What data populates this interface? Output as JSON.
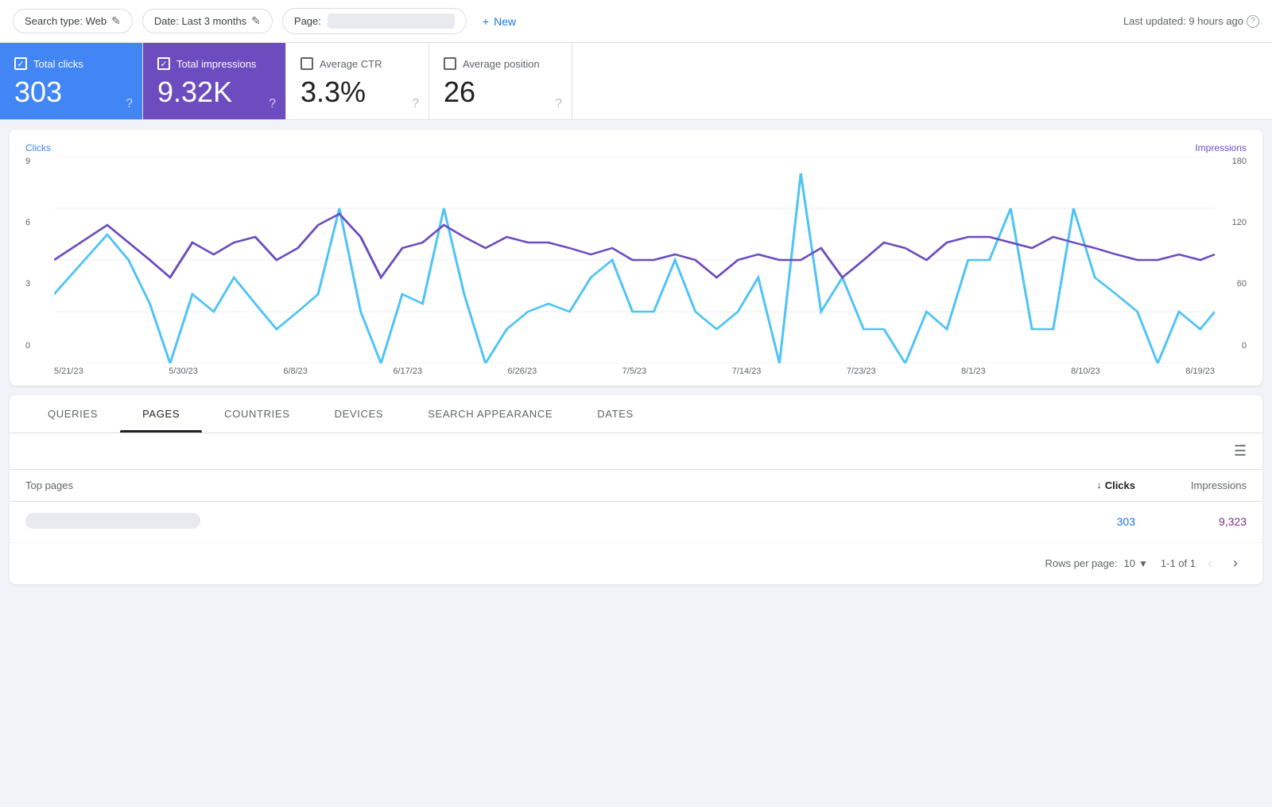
{
  "topbar": {
    "search_type_label": "Search type: Web",
    "edit_icon": "✎",
    "date_label": "Date: Last 3 months",
    "page_label": "Page:",
    "page_placeholder": "",
    "new_button_label": "New",
    "plus_icon": "+",
    "last_updated": "Last updated: 9 hours ago",
    "help_icon": "?"
  },
  "metrics": [
    {
      "id": "total-clicks",
      "label": "Total clicks",
      "value": "303",
      "state": "active-blue",
      "checked": true
    },
    {
      "id": "total-impressions",
      "label": "Total impressions",
      "value": "9.32K",
      "state": "active-purple",
      "checked": true
    },
    {
      "id": "average-ctr",
      "label": "Average CTR",
      "value": "3.3%",
      "state": "inactive",
      "checked": false
    },
    {
      "id": "average-position",
      "label": "Average position",
      "value": "26",
      "state": "inactive",
      "checked": false
    }
  ],
  "chart": {
    "left_axis_label": "Clicks",
    "right_axis_label": "Impressions",
    "left_axis_values": [
      "9",
      "6",
      "3",
      "0"
    ],
    "right_axis_values": [
      "180",
      "120",
      "60",
      "0"
    ],
    "x_axis_dates": [
      "5/21/23",
      "5/30/23",
      "6/8/23",
      "6/17/23",
      "6/26/23",
      "7/5/23",
      "7/14/23",
      "7/23/23",
      "8/1/23",
      "8/10/23",
      "8/19/23"
    ],
    "clicks_color": "#4fc3f7",
    "impressions_color": "#6c4cbf"
  },
  "tabs": [
    {
      "id": "queries",
      "label": "QUERIES",
      "active": false
    },
    {
      "id": "pages",
      "label": "PAGES",
      "active": true
    },
    {
      "id": "countries",
      "label": "COUNTRIES",
      "active": false
    },
    {
      "id": "devices",
      "label": "DEVICES",
      "active": false
    },
    {
      "id": "search-appearance",
      "label": "SEARCH APPEARANCE",
      "active": false
    },
    {
      "id": "dates",
      "label": "DATES",
      "active": false
    }
  ],
  "table": {
    "header_pages": "Top pages",
    "header_clicks": "Clicks",
    "header_impressions": "Impressions",
    "sort_icon": "↓",
    "rows": [
      {
        "url_display": "",
        "clicks": "303",
        "impressions": "9,323"
      }
    ]
  },
  "pagination": {
    "rows_per_page_label": "Rows per page:",
    "rows_per_page_value": "10",
    "page_range": "1-1 of 1"
  }
}
